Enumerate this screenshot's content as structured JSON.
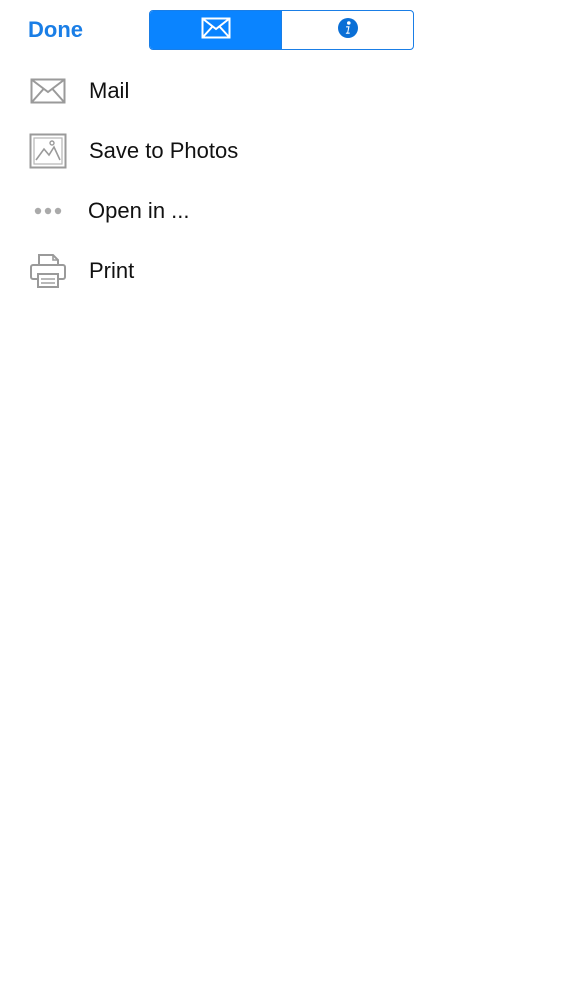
{
  "header": {
    "done_label": "Done",
    "segments": [
      {
        "icon": "mail-icon",
        "active": true
      },
      {
        "icon": "info-icon",
        "active": false
      }
    ]
  },
  "menu": {
    "items": [
      {
        "label": "Mail",
        "icon": "mail-icon"
      },
      {
        "label": "Save to Photos",
        "icon": "photo-icon"
      },
      {
        "label": "Open in ...",
        "icon": "more-icon"
      },
      {
        "label": "Print",
        "icon": "printer-icon"
      }
    ]
  },
  "colors": {
    "accent": "#0a84ff",
    "icon_gray": "#9a9a9a"
  }
}
